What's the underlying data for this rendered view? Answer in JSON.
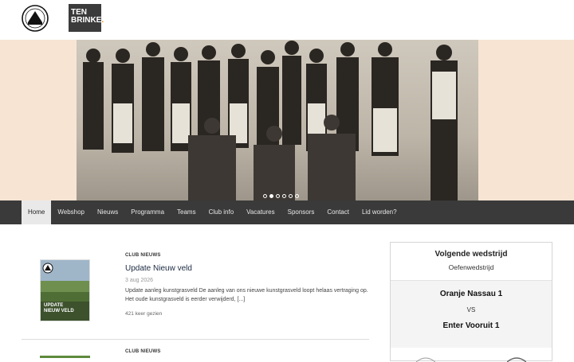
{
  "header": {
    "sponsor_line1": "TEN",
    "sponsor_line2": "BRINKE",
    "sponsor_dot": "."
  },
  "hero": {
    "slides_total": 6,
    "active_slide": 2
  },
  "nav": {
    "items": [
      "Home",
      "Webshop",
      "Nieuws",
      "Programma",
      "Teams",
      "Club info",
      "Vacatures",
      "Sponsors",
      "Contact",
      "Lid worden?"
    ],
    "active": "Home"
  },
  "news": [
    {
      "category": "CLUB NIEUWS",
      "title": "Update Nieuw veld",
      "date": "3 aug 2026",
      "excerpt": "Update aanleg kunstgrasveld De aanleg van ons nieuwe kunstgrasveld loopt helaas vertraging op. Het oude kunstgrasveld is eerder verwijderd, [...]",
      "views": "421 keer gezien",
      "thumb_line1": "UPDATE",
      "thumb_line2": "NIEUW VELD"
    },
    {
      "category": "CLUB NIEUWS"
    }
  ],
  "match": {
    "title": "Volgende wedstrijd",
    "subtitle": "Oefenwedstrijd",
    "home": "Oranje Nassau 1",
    "vs": "VS",
    "away": "Enter Vooruit 1"
  },
  "colors": {
    "nav_bg": "#3a3a3a",
    "hero_bg": "#f7e4d3",
    "accent": "#f08c1e"
  }
}
